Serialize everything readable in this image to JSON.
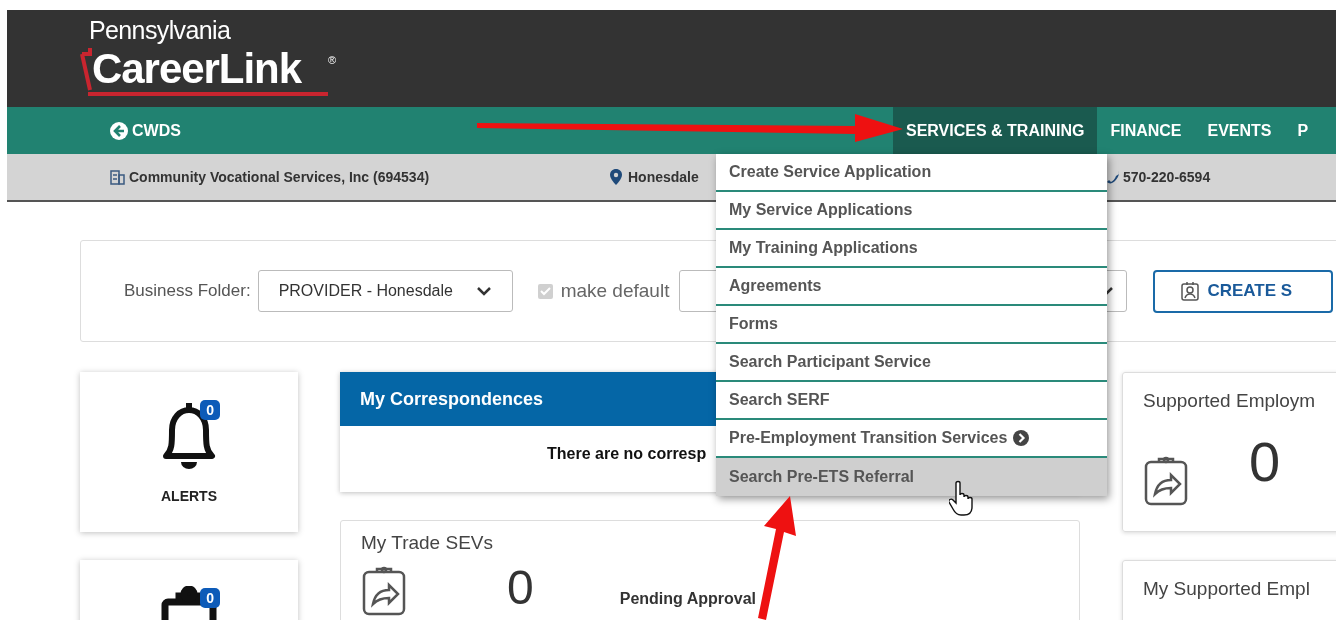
{
  "logo": {
    "state": "Pennsylvania",
    "name": "CareerLink",
    "mark": "®"
  },
  "nav": {
    "back_link": "CWDS",
    "items": [
      {
        "label": "SERVICES & TRAINING",
        "selected": true
      },
      {
        "label": "FINANCE",
        "selected": false
      },
      {
        "label": "EVENTS",
        "selected": false
      },
      {
        "label": "P",
        "selected": false
      }
    ]
  },
  "info_bar": {
    "organization": "Community Vocational Services, Inc (694534)",
    "location": "Honesdale",
    "phone": "570-220-6594"
  },
  "dropdown_menu": [
    {
      "label": "Create Service Application",
      "selected": false,
      "has_submenu": false
    },
    {
      "label": "My Service Applications",
      "selected": false,
      "has_submenu": false
    },
    {
      "label": "My Training Applications",
      "selected": false,
      "has_submenu": false
    },
    {
      "label": "Agreements",
      "selected": false,
      "has_submenu": false
    },
    {
      "label": "Forms",
      "selected": false,
      "has_submenu": false
    },
    {
      "label": "Search Participant Service",
      "selected": false,
      "has_submenu": false
    },
    {
      "label": "Search SERF",
      "selected": false,
      "has_submenu": false
    },
    {
      "label": "Pre-Employment Transition Services",
      "selected": false,
      "has_submenu": true
    },
    {
      "label": "Search Pre-ETS Referral",
      "selected": true,
      "has_submenu": false
    }
  ],
  "folder_bar": {
    "label": "Business Folder:",
    "value": "PROVIDER - Honesdale",
    "make_default": {
      "label": "make default",
      "checked": true,
      "disabled": true
    },
    "create_button": "CREATE S"
  },
  "tiles": [
    {
      "label": "ALERTS",
      "count": "0"
    },
    {
      "count": "0"
    }
  ],
  "correspondences": {
    "title": "My Correspondences",
    "message": "There are no corresp"
  },
  "trade_sevs": {
    "title": "My Trade SEVs",
    "count": "0",
    "status": "Pending Approval"
  },
  "right_cards": [
    {
      "title": "Supported Employm",
      "count": "0"
    },
    {
      "title": "My Supported Empl"
    }
  ]
}
